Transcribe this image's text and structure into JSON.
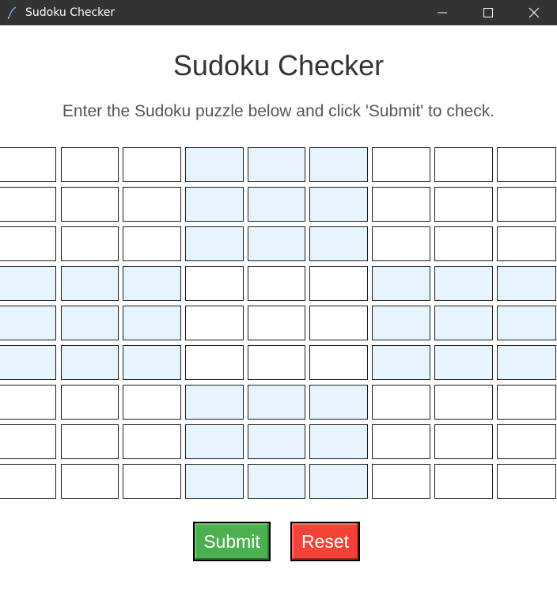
{
  "window": {
    "title": "Sudoku Checker"
  },
  "heading": "Sudoku Checker",
  "instructions": "Enter the Sudoku puzzle below and click 'Submit' to check.",
  "grid": {
    "rows": 9,
    "cols": 9,
    "values": [
      [
        "",
        "",
        "",
        "",
        "",
        "",
        "",
        "",
        ""
      ],
      [
        "",
        "",
        "",
        "",
        "",
        "",
        "",
        "",
        ""
      ],
      [
        "",
        "",
        "",
        "",
        "",
        "",
        "",
        "",
        ""
      ],
      [
        "",
        "",
        "",
        "",
        "",
        "",
        "",
        "",
        ""
      ],
      [
        "",
        "",
        "",
        "",
        "",
        "",
        "",
        "",
        ""
      ],
      [
        "",
        "",
        "",
        "",
        "",
        "",
        "",
        "",
        ""
      ],
      [
        "",
        "",
        "",
        "",
        "",
        "",
        "",
        "",
        ""
      ],
      [
        "",
        "",
        "",
        "",
        "",
        "",
        "",
        "",
        ""
      ],
      [
        "",
        "",
        "",
        "",
        "",
        "",
        "",
        "",
        ""
      ]
    ],
    "shaded_color": "#e6f5fd",
    "plain_color": "#ffffff"
  },
  "buttons": {
    "submit": {
      "label": "Submit",
      "color": "#4caf50"
    },
    "reset": {
      "label": "Reset",
      "color": "#f44336"
    }
  },
  "icons": {
    "app": "feather-pen-icon",
    "minimize": "minimize-icon",
    "maximize": "maximize-icon",
    "close": "close-icon"
  },
  "colors": {
    "titlebar": "#333333",
    "heading": "#333333",
    "instructions": "#555555"
  }
}
